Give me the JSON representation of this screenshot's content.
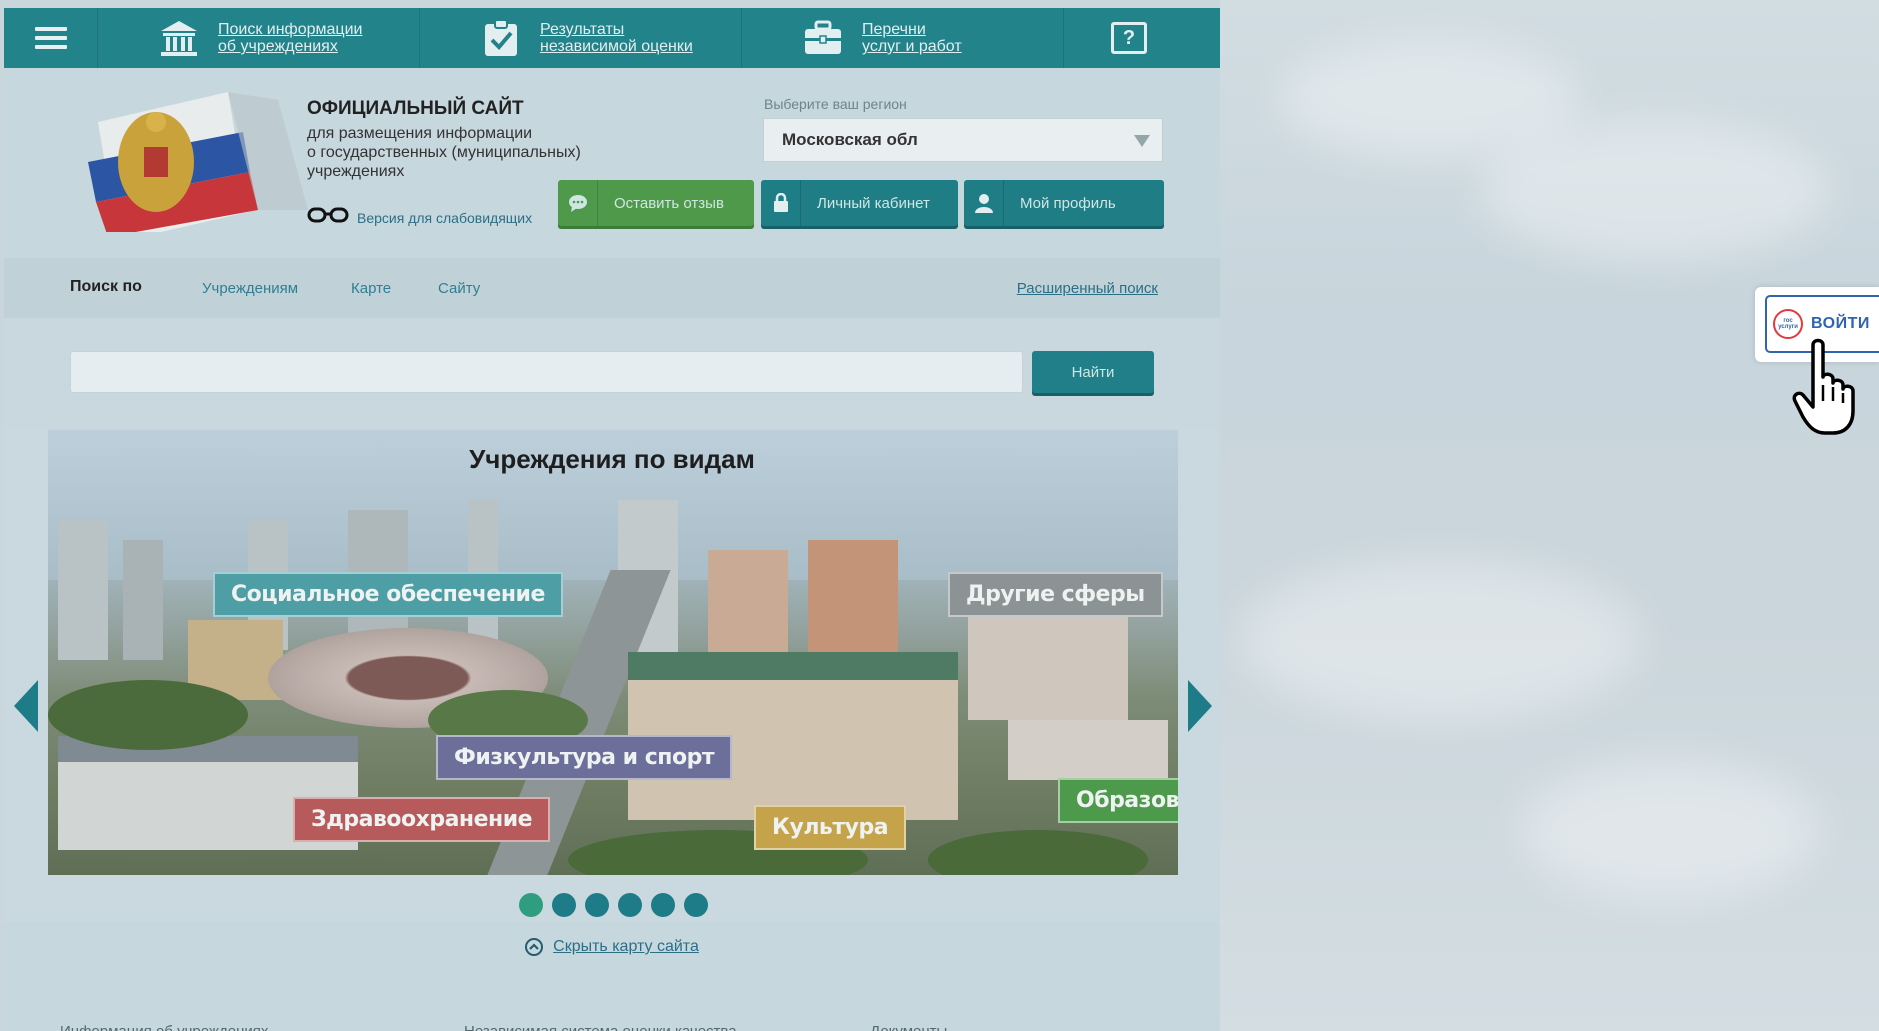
{
  "topbar": {
    "nav": [
      {
        "line1": "Поиск информации",
        "line2": "об учреждениях",
        "icon": "institution-icon"
      },
      {
        "line1": "Результаты",
        "line2": "независимой оценки",
        "icon": "clipboard-check-icon"
      },
      {
        "line1": "Перечни",
        "line2": "услуг и работ",
        "icon": "briefcase-icon"
      }
    ],
    "help": "?"
  },
  "header": {
    "title": "ОФИЦИАЛЬНЫЙ САЙТ",
    "subtitle_l1": "для размещения информации",
    "subtitle_l2": "о государственных (муниципальных)",
    "subtitle_l3": "учреждениях",
    "low_vision": "Версия для слабовидящих",
    "region_label": "Выберите ваш регион",
    "region_value": "Московская обл",
    "feedback_btn": "Оставить отзыв",
    "cabinet_btn": "Личный кабинет",
    "profile_btn": "Мой профиль"
  },
  "search": {
    "label": "Поиск по",
    "tabs": [
      "Учреждениям",
      "Карте",
      "Сайту"
    ],
    "advanced": "Расширенный поиск",
    "input_value": "",
    "button": "Найти"
  },
  "carousel": {
    "title": "Учреждения по видам",
    "tags": {
      "social": "Социальное обеспечение",
      "other": "Другие сферы",
      "sport": "Физкультура и спорт",
      "health": "Здравоохранение",
      "culture": "Культура",
      "education": "Образование"
    },
    "active_slide": 1,
    "slide_count": 6
  },
  "sitemap": {
    "hide": "Скрыть карту сайта",
    "col1": "Информация об учреждениях",
    "col2": "Независимая система оценки качества",
    "col3": "Документы"
  },
  "login_widget": {
    "logo_line1": "гос",
    "logo_line2": "услуги",
    "label": "ВОЙТИ"
  },
  "colors": {
    "primary": "#22838a",
    "green": "#4e9a4a",
    "login_blue": "#2e65ae",
    "gos_red": "#e4393c"
  }
}
